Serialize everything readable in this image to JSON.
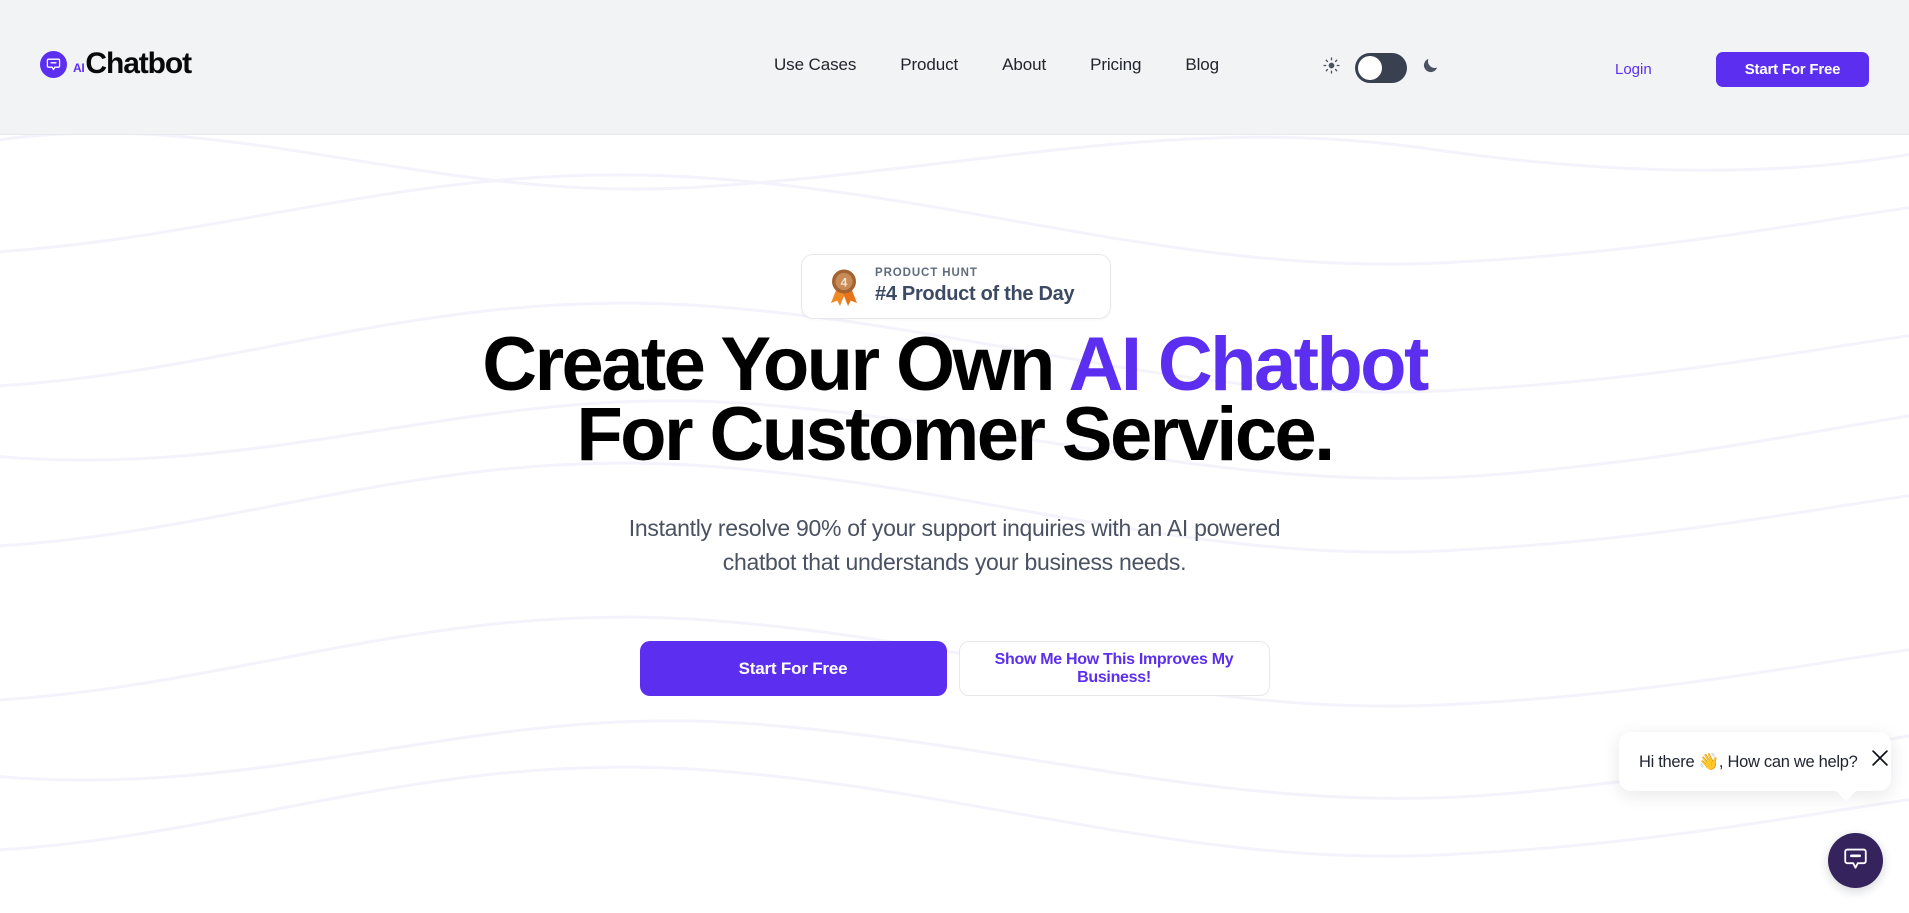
{
  "header": {
    "logo": {
      "ai_text": "AI",
      "name": "Chatbot",
      "icon": "chat-bubble-icon"
    },
    "nav": [
      {
        "label": "Use Cases"
      },
      {
        "label": "Product"
      },
      {
        "label": "About"
      },
      {
        "label": "Pricing"
      },
      {
        "label": "Blog"
      }
    ],
    "theme": {
      "light_icon": "sun-icon",
      "dark_icon": "moon-icon",
      "toggle_state": "light",
      "toggle_bg": "#394150",
      "knob_color": "#ffffff"
    },
    "login_label": "Login",
    "cta_label": "Start For Free",
    "background": "#f2f3f5"
  },
  "hero": {
    "badge": {
      "icon": "medal-icon",
      "medal_number": "4",
      "label": "PRODUCT HUNT",
      "title": "#4 Product of the Day"
    },
    "headline": {
      "line1_plain": "Create Your Own ",
      "line1_accent": "AI Chatbot",
      "line2": "For Customer Service."
    },
    "subheadline": "Instantly resolve 90% of your support inquiries with an AI powered chatbot that understands your business needs.",
    "primary_cta": "Start For Free",
    "secondary_cta": "Show Me How This Improves My Business!"
  },
  "chat_widget": {
    "message": "Hi there 👋, How can we help?",
    "close_icon": "close-icon",
    "launcher_icon": "chat-bubble-icon"
  },
  "colors": {
    "accent_purple": "#5b2ef0",
    "header_bg": "#f2f3f5",
    "text_dark": "#000000",
    "text_muted": "#4a5262",
    "badge_title": "#3c4a63",
    "launcher_bg": "#35235e",
    "wave_line": "#f4f3fb"
  }
}
